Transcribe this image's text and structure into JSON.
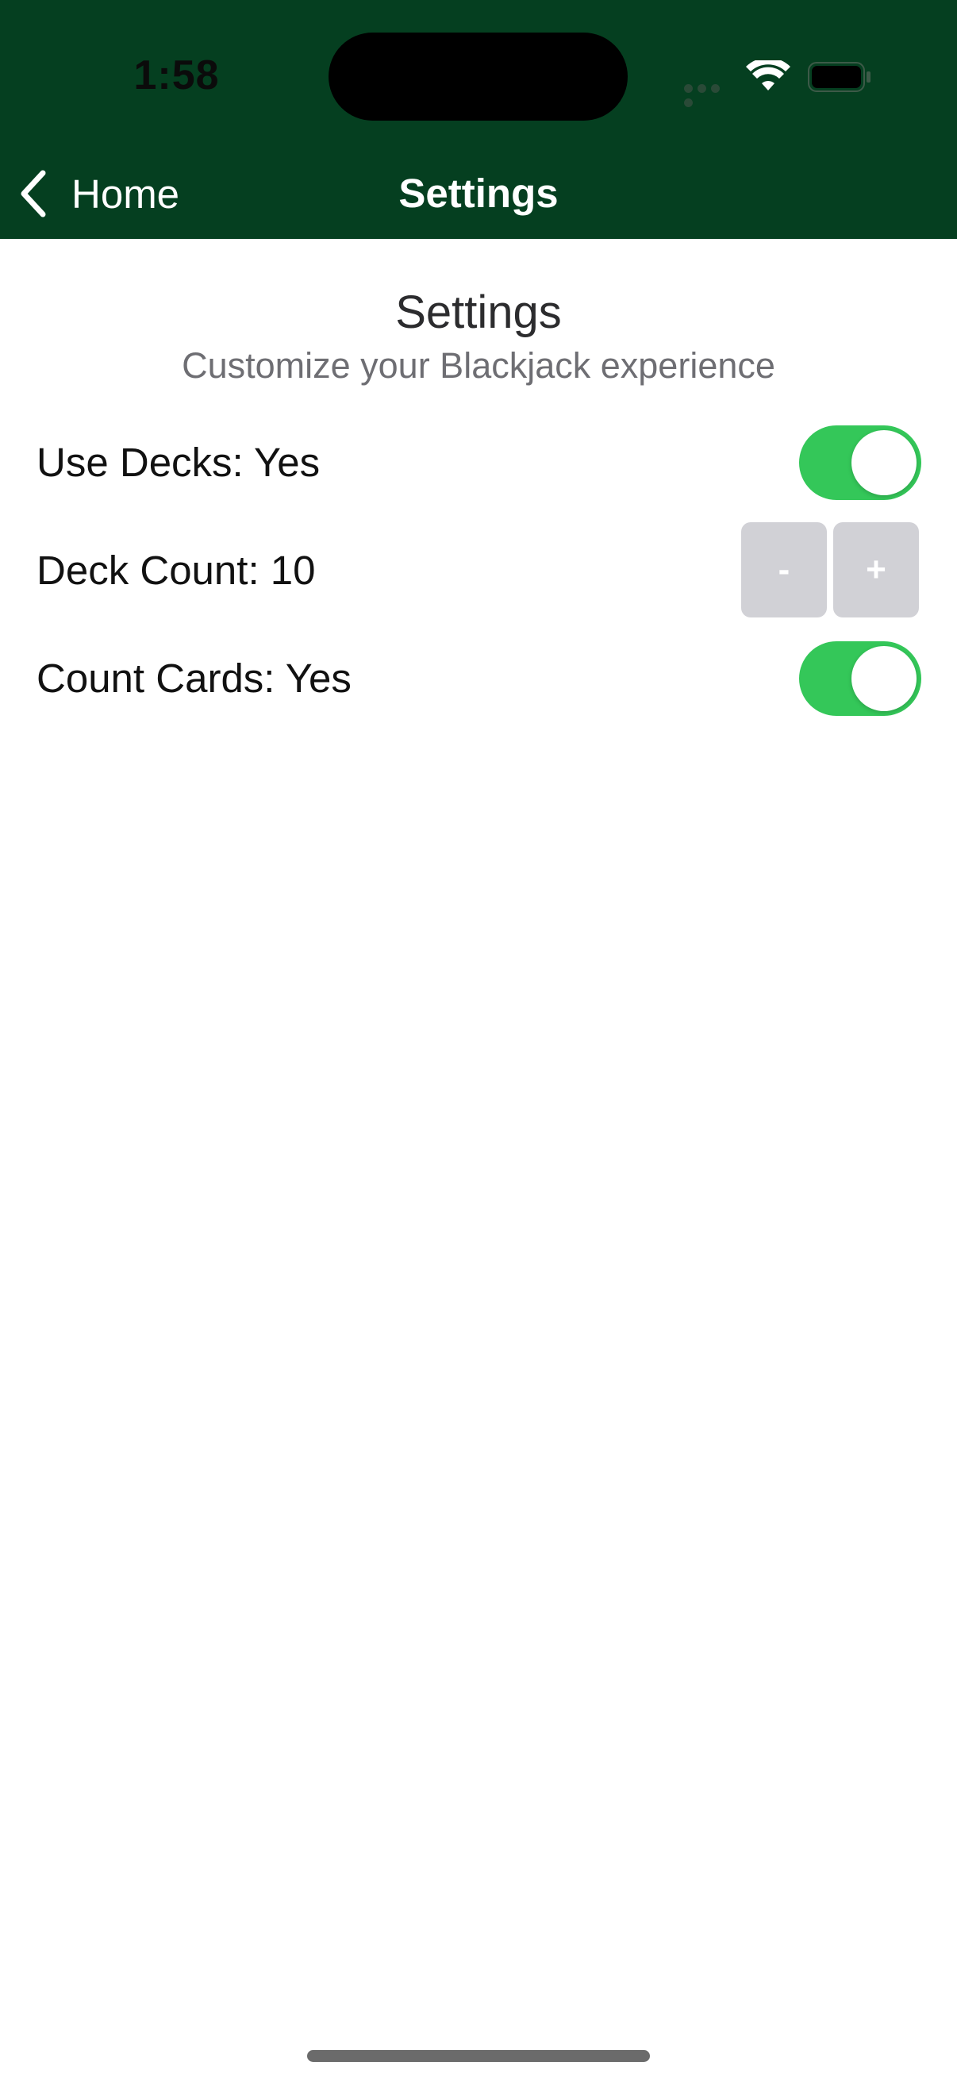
{
  "status_bar": {
    "time": "1:58"
  },
  "nav": {
    "back_label": "Home",
    "title": "Settings"
  },
  "content": {
    "title": "Settings",
    "subtitle": "Customize your Blackjack experience"
  },
  "settings": [
    {
      "label": "Use Decks: Yes",
      "control": "toggle",
      "on": true
    },
    {
      "label": "Deck Count: 10",
      "control": "stepper",
      "minus_label": "-",
      "plus_label": "+"
    },
    {
      "label": "Count Cards: Yes",
      "control": "toggle",
      "on": true
    }
  ],
  "colors": {
    "header_bg": "#053f20",
    "toggle_on": "#34c759",
    "stepper_bg": "#d1d1d6"
  },
  "icons": {
    "back": "chevron-left-icon",
    "wifi": "wifi-icon",
    "battery": "battery-icon",
    "signal": "cellular-signal-icon"
  }
}
